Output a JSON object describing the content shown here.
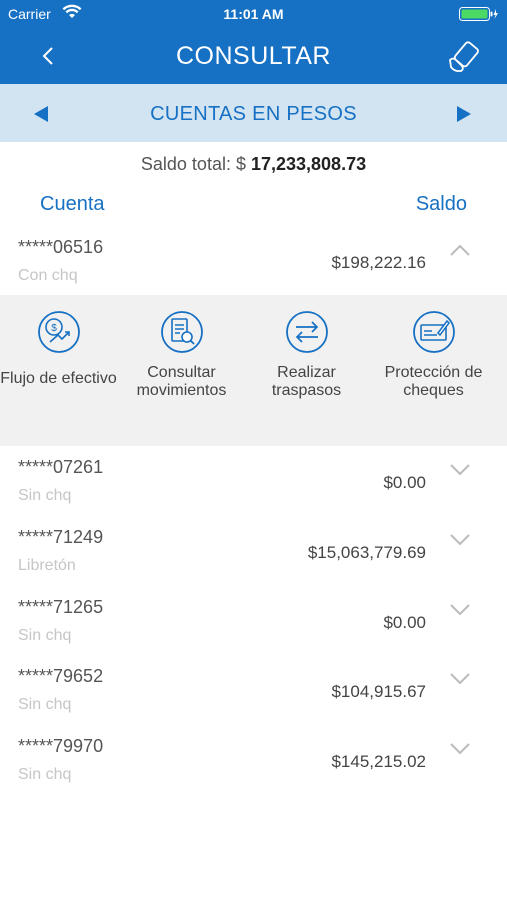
{
  "status_bar": {
    "carrier": "Carrier",
    "time": "11:01 AM"
  },
  "nav": {
    "title": "CONSULTAR",
    "back_icon": "chevron-left-icon",
    "menu_icon": "hand-phone-icon"
  },
  "switcher": {
    "label": "CUENTAS EN PESOS"
  },
  "total": {
    "label": "Saldo total: $",
    "amount": "17,233,808.73"
  },
  "columns": {
    "left": "Cuenta",
    "right": "Saldo"
  },
  "accounts": [
    {
      "number": "*****06516",
      "type": "Con chq",
      "balance": "$198,222.16",
      "expanded": true
    },
    {
      "number": "*****07261",
      "type": "Sin chq",
      "balance": "$0.00",
      "expanded": false
    },
    {
      "number": "*****71249",
      "type": "Libretón",
      "balance": "$15,063,779.69",
      "expanded": false
    },
    {
      "number": "*****71265",
      "type": "Sin chq",
      "balance": "$0.00",
      "expanded": false
    },
    {
      "number": "*****79652",
      "type": "Sin chq",
      "balance": "$104,915.67",
      "expanded": false
    },
    {
      "number": "*****79970",
      "type": "Sin chq",
      "balance": "$145,215.02",
      "expanded": false
    }
  ],
  "actions": [
    {
      "label": "Flujo de efectivo",
      "icon": "cash-flow-icon"
    },
    {
      "label": "Consultar movimientos",
      "icon": "document-search-icon"
    },
    {
      "label": "Realizar traspasos",
      "icon": "transfer-arrows-icon"
    },
    {
      "label": "Protección de cheques",
      "icon": "check-protection-icon"
    }
  ],
  "colors": {
    "primary": "#1670c3",
    "switcher_bg": "#d2e4f2",
    "actions_bg": "#f1f1f1"
  }
}
